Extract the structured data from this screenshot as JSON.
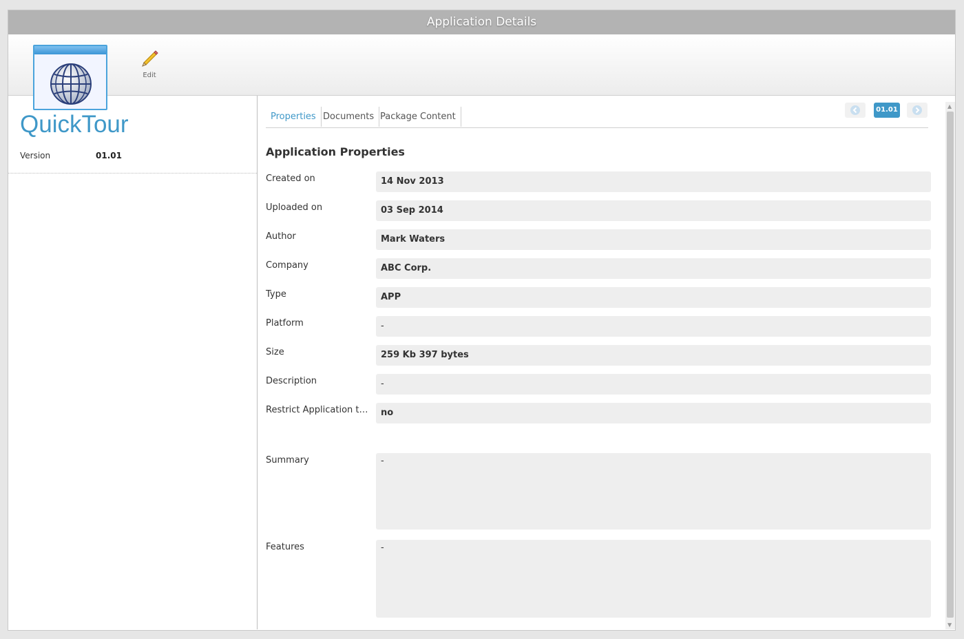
{
  "window": {
    "title": "Application Details"
  },
  "toolbar": {
    "edit_label": "Edit"
  },
  "app": {
    "name": "QuickTour",
    "version_label": "Version",
    "version_value": "01.01"
  },
  "tabs": [
    {
      "label": "Properties",
      "active": true
    },
    {
      "label": "Documents",
      "active": false
    },
    {
      "label": "Package Content",
      "active": false
    }
  ],
  "version_nav": {
    "badge": "01.01"
  },
  "section_title": "Application Properties",
  "properties": [
    {
      "key": "Created on",
      "value": "14 Nov 2013"
    },
    {
      "key": "Uploaded on",
      "value": "03 Sep 2014"
    },
    {
      "key": "Author",
      "value": "Mark Waters"
    },
    {
      "key": "Company",
      "value": "ABC Corp."
    },
    {
      "key": "Type",
      "value": "APP"
    },
    {
      "key": "Platform",
      "value": "-"
    },
    {
      "key": "Size",
      "value": "259 Kb 397 bytes"
    },
    {
      "key": "Description",
      "value": "-"
    },
    {
      "key": "Restrict Application to...",
      "value": "no"
    },
    {
      "key": "Summary",
      "value": "-"
    },
    {
      "key": "Features",
      "value": "-"
    }
  ],
  "colors": {
    "accent": "#3f98c8",
    "titlebar": "#b3b3b3",
    "field_bg": "#eeeeee"
  }
}
